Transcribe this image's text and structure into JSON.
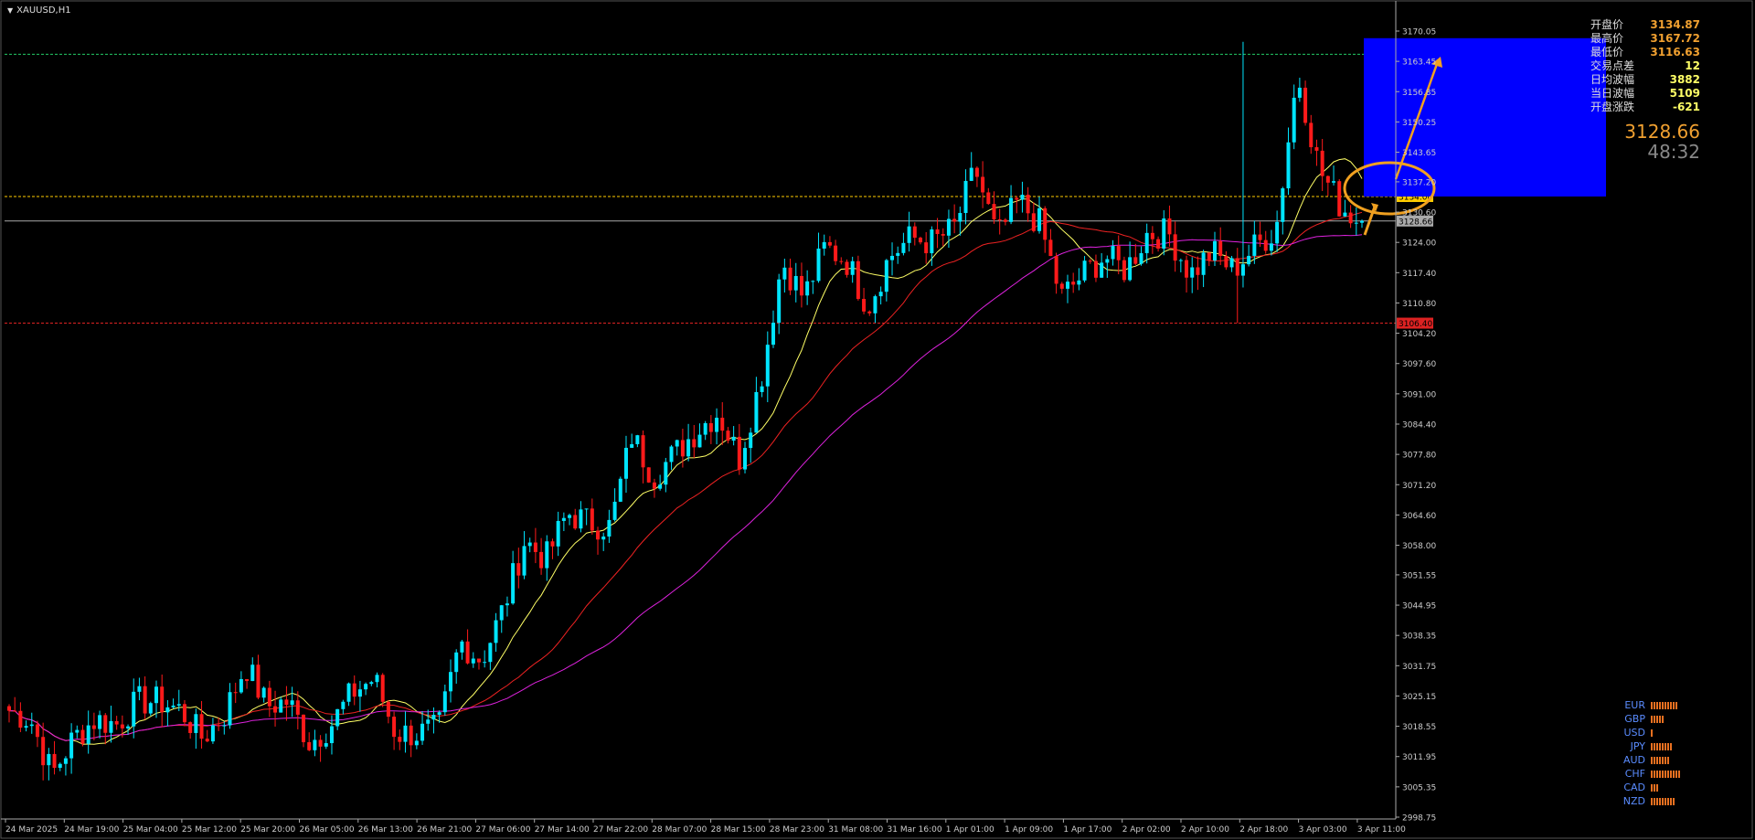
{
  "chart_header": {
    "symbol": "XAUUSD,H1"
  },
  "info_panel": [
    {
      "label": "开盘价",
      "value": "3134.87",
      "color": "#f0a030"
    },
    {
      "label": "最高价",
      "value": "3167.72",
      "color": "#f0a030"
    },
    {
      "label": "最低价",
      "value": "3116.63",
      "color": "#f0a030"
    },
    {
      "label": "交易点差",
      "value": "12",
      "color": "#ffff66"
    },
    {
      "label": "日均波幅",
      "value": "3882",
      "color": "#ffff66"
    },
    {
      "label": "当日波幅",
      "value": "5109",
      "color": "#ffff66"
    },
    {
      "label": "开盘涨跌",
      "value": "-621",
      "color": "#ffff66"
    }
  ],
  "current_price": "3128.66",
  "countdown": "48:32",
  "currency_strength": [
    {
      "name": "EUR",
      "bars": 10
    },
    {
      "name": "GBP",
      "bars": 5
    },
    {
      "name": "USD",
      "bars": 1
    },
    {
      "name": "JPY",
      "bars": 8
    },
    {
      "name": "AUD",
      "bars": 7
    },
    {
      "name": "CHF",
      "bars": 11
    },
    {
      "name": "CAD",
      "bars": 3
    },
    {
      "name": "NZD",
      "bars": 9
    }
  ],
  "chart_data": {
    "type": "candlestick",
    "symbol": "XAUUSD",
    "timeframe": "H1",
    "y_ticks": [
      "3170.05",
      "3163.45",
      "3156.85",
      "3150.25",
      "3143.65",
      "3137.20",
      "3130.60",
      "3124.00",
      "3117.40",
      "3110.80",
      "3104.20",
      "3097.60",
      "3091.00",
      "3084.40",
      "3077.80",
      "3071.20",
      "3064.60",
      "3058.00",
      "3051.55",
      "3044.95",
      "3038.35",
      "3031.75",
      "3025.15",
      "3018.55",
      "3011.95",
      "3005.35",
      "2998.75"
    ],
    "x_labels": [
      "24 Mar 2025",
      "24 Mar 19:00",
      "25 Mar 04:00",
      "25 Mar 12:00",
      "25 Mar 20:00",
      "26 Mar 05:00",
      "26 Mar 13:00",
      "26 Mar 21:00",
      "27 Mar 06:00",
      "27 Mar 14:00",
      "27 Mar 22:00",
      "28 Mar 07:00",
      "28 Mar 15:00",
      "28 Mar 23:00",
      "31 Mar 08:00",
      "31 Mar 16:00",
      "1 Apr 01:00",
      "1 Apr 09:00",
      "1 Apr 17:00",
      "2 Apr 02:00",
      "2 Apr 10:00",
      "2 Apr 18:00",
      "3 Apr 03:00",
      "3 Apr 11:00"
    ],
    "ylim": [
      2998.75,
      3170.05
    ],
    "horizontal_levels": [
      {
        "price": 3165.0,
        "label": "3165.00",
        "color": "#22cc66",
        "style": "dashed"
      },
      {
        "price": 3134.0,
        "label": "3134.00",
        "color": "#ffcc00",
        "style": "dashed"
      },
      {
        "price": 3128.66,
        "label": "3128.66",
        "color": "#aaaaaa",
        "style": "solid"
      },
      {
        "price": 3106.4,
        "label": "3106.40",
        "color": "#dd2222",
        "style": "dashed"
      }
    ],
    "target_box": {
      "price_top": 3168.5,
      "price_bottom": 3134.0,
      "color": "#0000ff"
    },
    "moving_average_colors": [
      "#ffff66",
      "#ee2222",
      "#dd22dd"
    ],
    "bull_color": "#00e5ff",
    "bear_color": "#ff1a1a",
    "anchors_close": [
      3022,
      3020,
      3008,
      3016,
      3020,
      3019,
      3024,
      3024,
      3022,
      3016,
      3021,
      3032,
      3023,
      3024,
      3015,
      3019,
      3026,
      3029,
      3017,
      3017,
      3018,
      3037,
      3033,
      3044,
      3059,
      3055,
      3065,
      3063,
      3062,
      3082,
      3073,
      3078,
      3083,
      3087,
      3077,
      3094,
      3120,
      3112,
      3123,
      3120,
      3110,
      3121,
      3125,
      3124,
      3127,
      3140,
      3125,
      3133,
      3128,
      3112,
      3117,
      3121,
      3118,
      3126,
      3126,
      3117,
      3122,
      3118,
      3123,
      3127,
      3161,
      3140,
      3132,
      3128
    ],
    "last_close": 3128.66
  }
}
